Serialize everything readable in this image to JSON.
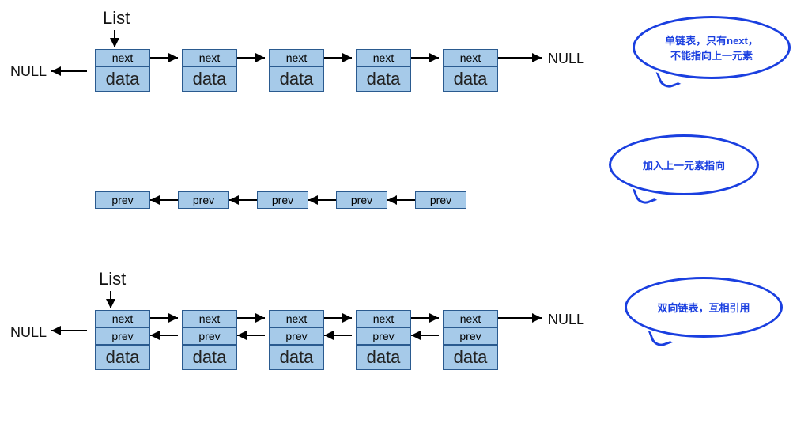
{
  "labels": {
    "list": "List",
    "null": "NULL",
    "next": "next",
    "prev": "prev",
    "data": "data"
  },
  "bubbles": {
    "b1_line1": "单链表，只有next，",
    "b1_line2": "不能指向上一元素",
    "b2": "加入上一元素指向",
    "b3": "双向链表，互相引用"
  },
  "structure": {
    "singly_list_nodes": 5,
    "prev_row_nodes": 5,
    "doubly_list_nodes": 5
  }
}
